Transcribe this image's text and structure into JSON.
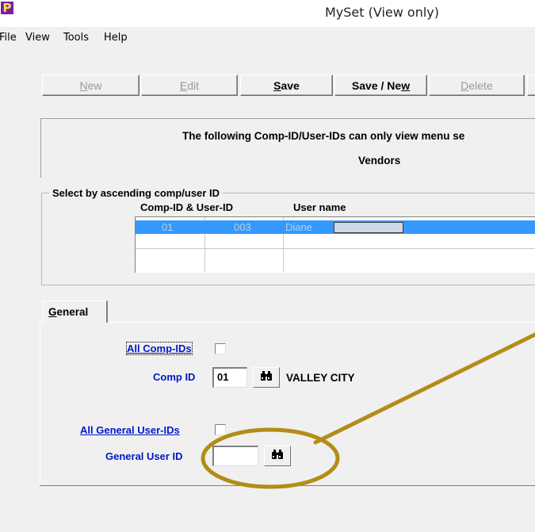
{
  "window": {
    "title": "MySet (View only)",
    "app_icon": "P"
  },
  "menu": [
    "File",
    "View",
    "Tools",
    "Help"
  ],
  "toolbar": {
    "new": {
      "pre": "",
      "u": "N",
      "post": "ew"
    },
    "edit": {
      "pre": "",
      "u": "E",
      "post": "dit"
    },
    "save": {
      "pre": "",
      "u": "S",
      "post": "ave"
    },
    "save_new": {
      "pre": "Save / Ne",
      "u": "w",
      "post": ""
    },
    "delete": {
      "pre": "",
      "u": "D",
      "post": "elete"
    }
  },
  "info": {
    "line1": "The following Comp-ID/User-IDs can only view menu se",
    "line2": "Vendors"
  },
  "select_group": {
    "legend": "Select by ascending comp/user ID",
    "col_comp_user": "Comp-ID & User-ID",
    "col_user_name": "User name",
    "rows": [
      {
        "comp": "01",
        "user": "003",
        "name": "Diane"
      }
    ]
  },
  "tabs": {
    "general_pre": "",
    "general_u": "G",
    "general_post": "eneral"
  },
  "form": {
    "all_comp_ids_label": "All Comp-IDs",
    "comp_id_label": "Comp ID",
    "comp_id_value": "01",
    "comp_name": "VALLEY CITY",
    "all_general_user_ids_label": "All General User-IDs",
    "general_user_id_label": "General User ID",
    "general_user_id_value": ""
  },
  "colors": {
    "selection": "#3399ff",
    "field_label": "#0018c8",
    "annotation": "#b28d17"
  }
}
